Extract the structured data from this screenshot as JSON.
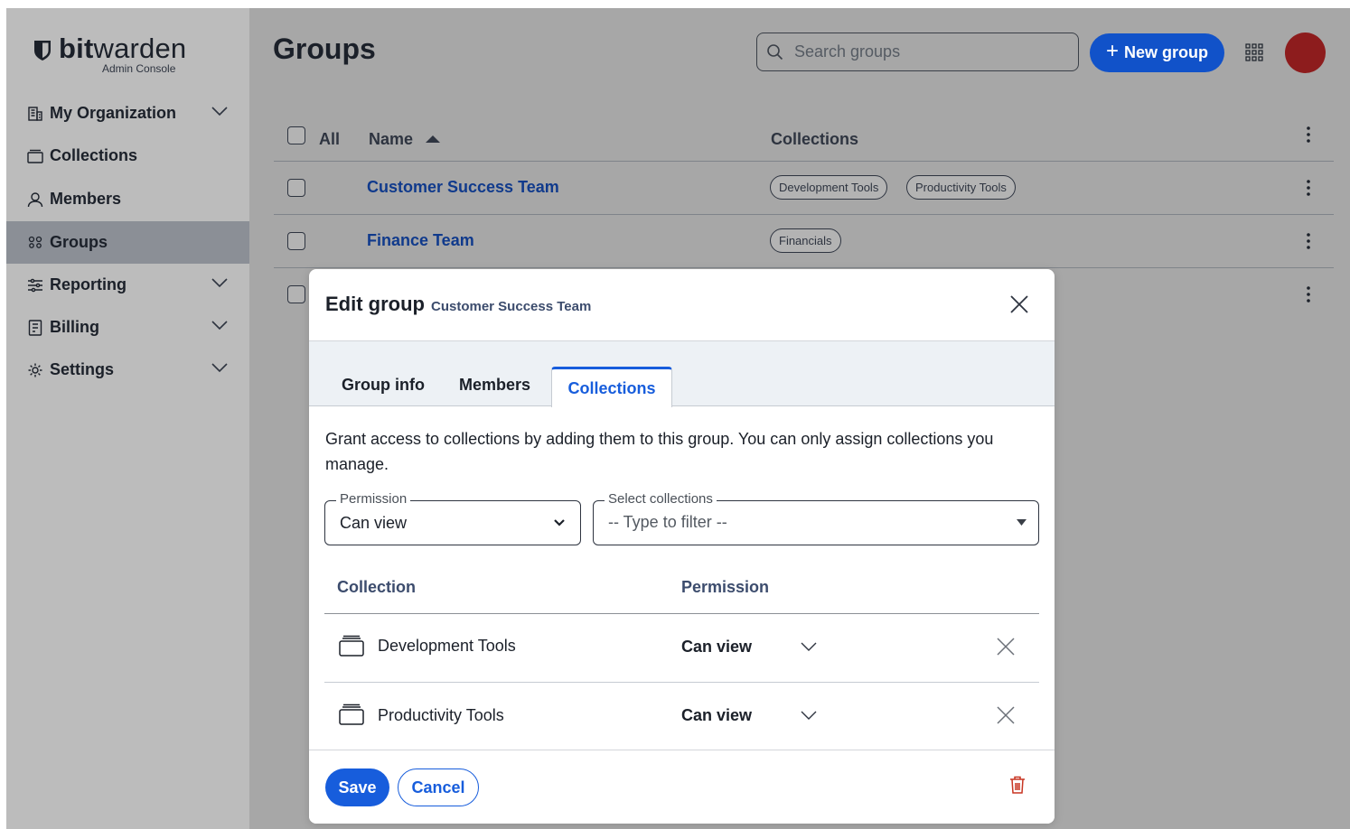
{
  "app": {
    "brand_bold": "bit",
    "brand_light": "warden",
    "brand_sub": "Admin Console"
  },
  "sidebar": {
    "items": [
      {
        "label": "My Organization",
        "icon": "organization-icon",
        "expandable": true
      },
      {
        "label": "Collections",
        "icon": "collection-icon",
        "expandable": false
      },
      {
        "label": "Members",
        "icon": "user-icon",
        "expandable": false
      },
      {
        "label": "Groups",
        "icon": "groups-icon",
        "expandable": false,
        "active": true
      },
      {
        "label": "Reporting",
        "icon": "sliders-icon",
        "expandable": true
      },
      {
        "label": "Billing",
        "icon": "billing-icon",
        "expandable": true
      },
      {
        "label": "Settings",
        "icon": "gear-icon",
        "expandable": true
      }
    ]
  },
  "header": {
    "title": "Groups",
    "search_placeholder": "Search groups",
    "new_button": "New group"
  },
  "table": {
    "col_all": "All",
    "col_name": "Name",
    "col_collections": "Collections",
    "rows": [
      {
        "name": "Customer Success Team",
        "collections": [
          "Development Tools",
          "Productivity Tools"
        ]
      },
      {
        "name": "Finance Team",
        "collections": [
          "Financials"
        ]
      }
    ]
  },
  "modal": {
    "title": "Edit group",
    "subtitle": "Customer Success Team",
    "tabs": [
      "Group info",
      "Members",
      "Collections"
    ],
    "active_tab": "Collections",
    "description": "Grant access to collections by adding them to this group. You can only assign collections you manage.",
    "permission_label": "Permission",
    "permission_value": "Can view",
    "select_label": "Select collections",
    "select_placeholder": "-- Type to filter --",
    "col_collection": "Collection",
    "col_permission": "Permission",
    "items": [
      {
        "name": "Development Tools",
        "permission": "Can view"
      },
      {
        "name": "Productivity Tools",
        "permission": "Can view"
      }
    ],
    "save": "Save",
    "cancel": "Cancel"
  },
  "colors": {
    "accent": "#175ddc",
    "avatar": "#8d1c1d",
    "danger": "#c83522"
  }
}
